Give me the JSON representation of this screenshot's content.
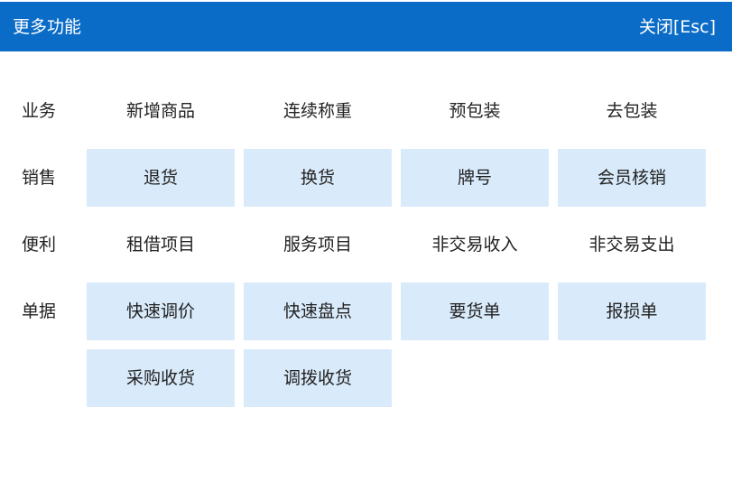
{
  "header": {
    "title": "更多功能",
    "close_label": "关闭[Esc]"
  },
  "rows": [
    {
      "label": "业务",
      "items": [
        "新增商品",
        "连续称重",
        "预包装",
        "去包装"
      ]
    },
    {
      "label": "销售",
      "items": [
        "退货",
        "换货",
        "牌号",
        "会员核销"
      ]
    },
    {
      "label": "便利",
      "items": [
        "租借项目",
        "服务项目",
        "非交易收入",
        "非交易支出"
      ]
    },
    {
      "label": "单据",
      "items": [
        "快速调价",
        "快速盘点",
        "要货单",
        "报损单",
        "采购收货",
        "调拨收货"
      ]
    }
  ],
  "colors": {
    "titlebar": "#0a6cc7",
    "button_fill": "#d9ebfb"
  }
}
